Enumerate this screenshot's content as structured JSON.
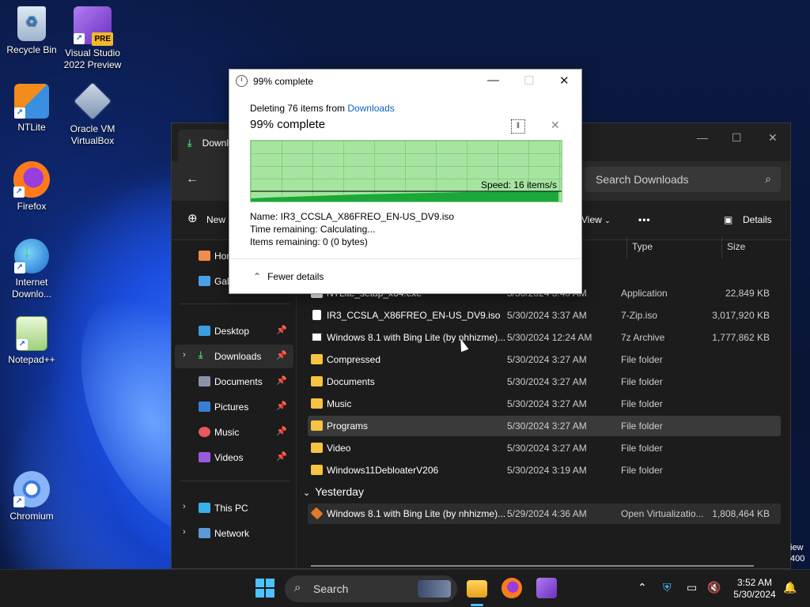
{
  "desktop": {
    "icons": [
      {
        "label": "Recycle Bin"
      },
      {
        "label": "Visual Studio 2022 Preview",
        "badge": "PRE"
      },
      {
        "label": "NTLite"
      },
      {
        "label": "Oracle VM VirtualBox"
      },
      {
        "label": "Firefox"
      },
      {
        "label": "Internet Downlo..."
      },
      {
        "label": "Notepad++"
      },
      {
        "label": "Chromium"
      }
    ]
  },
  "explorer": {
    "tab_title": "Downloads",
    "search_placeholder": "Search Downloads",
    "cmd": {
      "new": "New",
      "view": "View",
      "more": "•••",
      "details": "Details"
    },
    "columns": {
      "type": "Type",
      "size": "Size"
    },
    "sidebar": [
      {
        "label": "Home"
      },
      {
        "label": "Gallery"
      },
      {
        "label": "Desktop"
      },
      {
        "label": "Downloads"
      },
      {
        "label": "Documents"
      },
      {
        "label": "Pictures"
      },
      {
        "label": "Music"
      },
      {
        "label": "Videos"
      },
      {
        "label": "This PC"
      },
      {
        "label": "Network"
      }
    ],
    "rows": [
      {
        "name": "NTLite_setup_x64.exe",
        "date": "5/30/2024 3:40 AM",
        "type": "Application",
        "size": "22,849 KB"
      },
      {
        "name": "IR3_CCSLA_X86FREO_EN-US_DV9.iso",
        "date": "5/30/2024 3:37 AM",
        "type": "7-Zip.iso",
        "size": "3,017,920 KB"
      },
      {
        "name": "Windows 8.1 with Bing Lite (by nhhizme)...",
        "date": "5/30/2024 12:24 AM",
        "type": "7z Archive",
        "size": "1,777,862 KB"
      },
      {
        "name": "Compressed",
        "date": "5/30/2024 3:27 AM",
        "type": "File folder",
        "size": ""
      },
      {
        "name": "Documents",
        "date": "5/30/2024 3:27 AM",
        "type": "File folder",
        "size": ""
      },
      {
        "name": "Music",
        "date": "5/30/2024 3:27 AM",
        "type": "File folder",
        "size": ""
      },
      {
        "name": "Programs",
        "date": "5/30/2024 3:27 AM",
        "type": "File folder",
        "size": ""
      },
      {
        "name": "Video",
        "date": "5/30/2024 3:27 AM",
        "type": "File folder",
        "size": ""
      },
      {
        "name": "Windows11DebloaterV206",
        "date": "5/30/2024 3:19 AM",
        "type": "File folder",
        "size": ""
      }
    ],
    "group_yesterday": "Yesterday",
    "yesterday_rows": [
      {
        "name": "Windows 8.1 with Bing Lite (by nhhizme)...",
        "date": "5/29/2024 4:36 AM",
        "type": "Open Virtualizatio...",
        "size": "1,808,464 KB"
      }
    ],
    "edge_text": "iew\n400"
  },
  "dialog": {
    "title": "99% complete",
    "subtitle_prefix": "Deleting 76 items from ",
    "subtitle_link": "Downloads",
    "headline": "99% complete",
    "progress_percent": 99,
    "speed": "Speed: 16 items/s",
    "name_line": "Name:  IR3_CCSLA_X86FREO_EN-US_DV9.iso",
    "time_line": "Time remaining:  Calculating...",
    "items_line": "Items remaining:  0 (0 bytes)",
    "fewer_details": "Fewer details"
  },
  "taskbar": {
    "search": "Search",
    "time": "3:52 AM",
    "date": "5/30/2024"
  }
}
